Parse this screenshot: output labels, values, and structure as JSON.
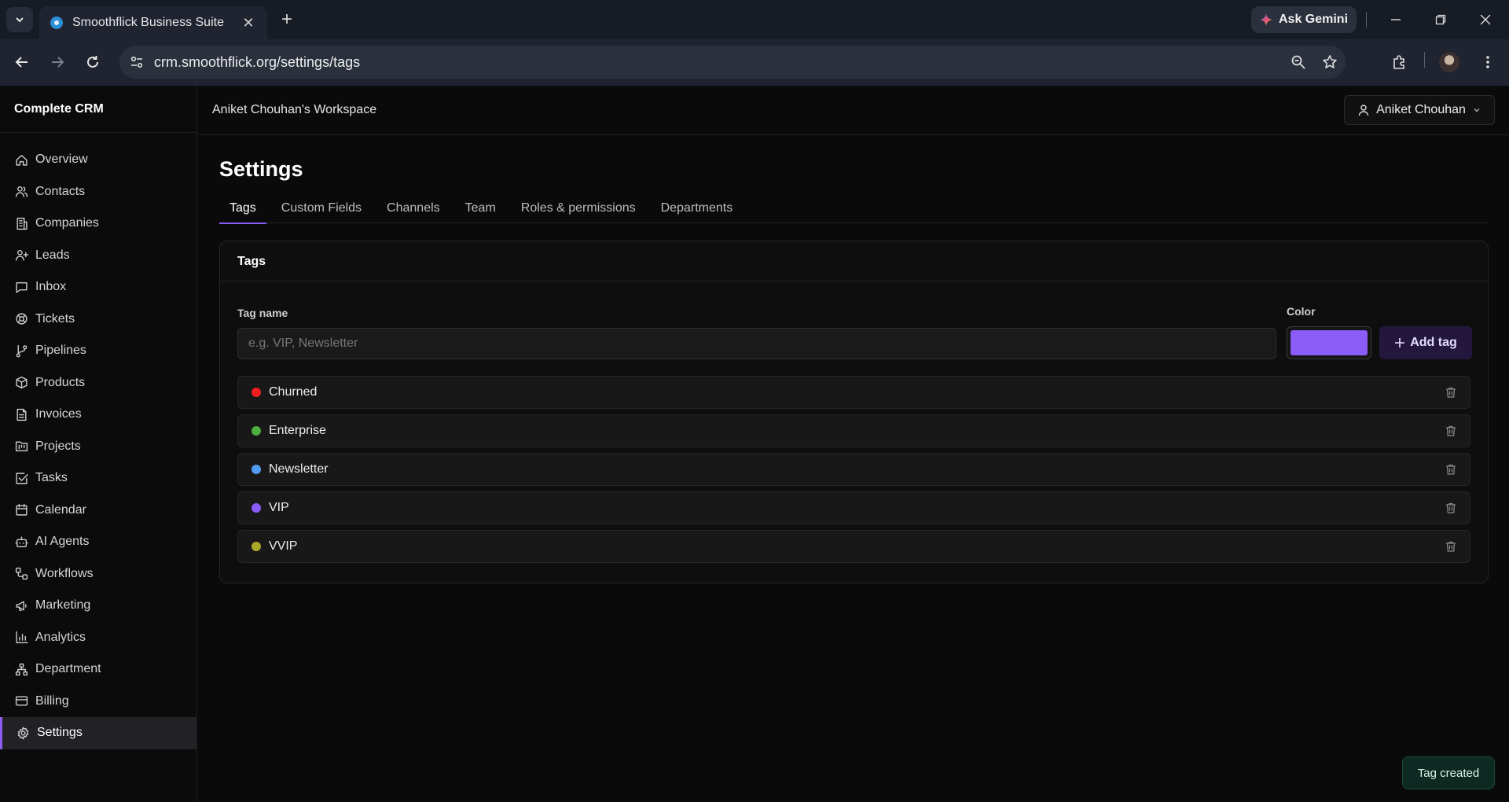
{
  "browser": {
    "tab_title": "Smoothflick Business Suite",
    "url": "crm.smoothflick.org/settings/tags",
    "gemini_label": "Ask Gemini"
  },
  "sidebar": {
    "brand": "Complete CRM",
    "items": [
      {
        "label": "Overview",
        "icon": "home-icon"
      },
      {
        "label": "Contacts",
        "icon": "users-icon"
      },
      {
        "label": "Companies",
        "icon": "building-icon"
      },
      {
        "label": "Leads",
        "icon": "user-plus-icon"
      },
      {
        "label": "Inbox",
        "icon": "message-icon"
      },
      {
        "label": "Tickets",
        "icon": "lifebuoy-icon"
      },
      {
        "label": "Pipelines",
        "icon": "git-branch-icon"
      },
      {
        "label": "Products",
        "icon": "package-icon"
      },
      {
        "label": "Invoices",
        "icon": "file-text-icon"
      },
      {
        "label": "Projects",
        "icon": "folder-kanban-icon"
      },
      {
        "label": "Tasks",
        "icon": "check-square-icon"
      },
      {
        "label": "Calendar",
        "icon": "calendar-icon"
      },
      {
        "label": "AI Agents",
        "icon": "bot-icon"
      },
      {
        "label": "Workflows",
        "icon": "workflow-icon"
      },
      {
        "label": "Marketing",
        "icon": "megaphone-icon"
      },
      {
        "label": "Analytics",
        "icon": "bar-chart-icon"
      },
      {
        "label": "Department",
        "icon": "network-icon"
      },
      {
        "label": "Billing",
        "icon": "credit-card-icon"
      },
      {
        "label": "Settings",
        "icon": "gear-icon"
      }
    ],
    "active": "Settings"
  },
  "header": {
    "workspace": "Aniket Chouhan's Workspace",
    "user_name": "Aniket Chouhan"
  },
  "page": {
    "title": "Settings",
    "tabs": [
      "Tags",
      "Custom Fields",
      "Channels",
      "Team",
      "Roles & permissions",
      "Departments"
    ],
    "active_tab": "Tags"
  },
  "tags_card": {
    "title": "Tags",
    "tag_name_label": "Tag name",
    "tag_name_placeholder": "e.g. VIP, Newsletter",
    "tag_name_value": "",
    "color_label": "Color",
    "color_value": "#8b5cf6",
    "add_label": "Add tag",
    "tags": [
      {
        "name": "Churned",
        "color": "#ef1d1d"
      },
      {
        "name": "Enterprise",
        "color": "#4caf3f"
      },
      {
        "name": "Newsletter",
        "color": "#4f9cf0"
      },
      {
        "name": "VIP",
        "color": "#8b5cf6"
      },
      {
        "name": "VVIP",
        "color": "#a9a62a"
      }
    ]
  },
  "toast": "Tag created"
}
